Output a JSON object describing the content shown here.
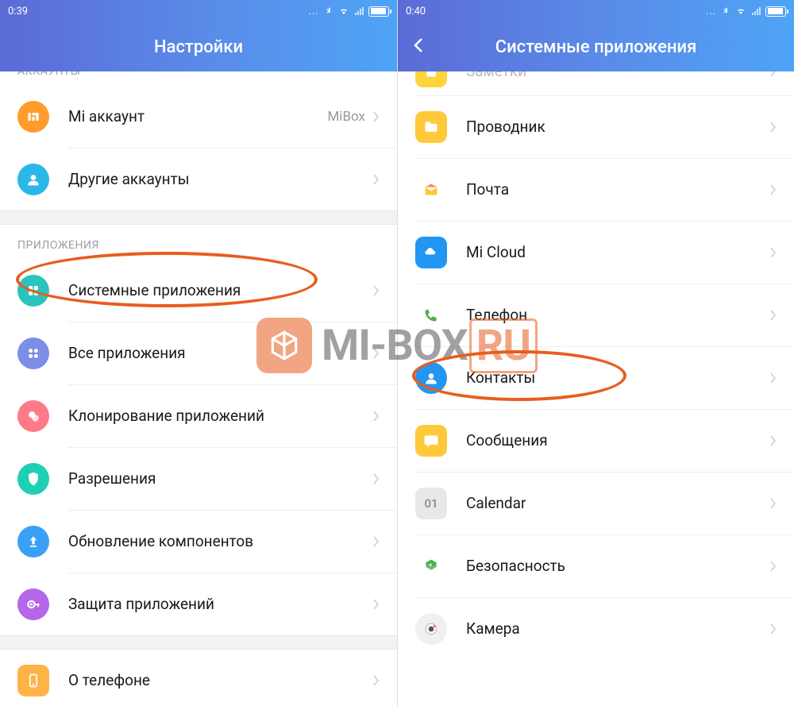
{
  "left": {
    "status_time": "0:39",
    "header_title": "Настройки",
    "section_accounts": "АККАУНТЫ",
    "section_apps": "ПРИЛОЖЕНИЯ",
    "rows": {
      "mi_account": {
        "label": "Mi аккаунт",
        "value": "MiBox"
      },
      "other_accounts": {
        "label": "Другие аккаунты"
      },
      "system_apps": {
        "label": "Системные приложения"
      },
      "all_apps": {
        "label": "Все приложения"
      },
      "clone_apps": {
        "label": "Клонирование приложений"
      },
      "permissions": {
        "label": "Разрешения"
      },
      "component_update": {
        "label": "Обновление компонентов"
      },
      "app_lock": {
        "label": "Защита приложений"
      },
      "about_phone": {
        "label": "О телефоне"
      }
    }
  },
  "right": {
    "status_time": "0:40",
    "header_title": "Системные приложения",
    "rows": {
      "notes": {
        "label": "Заметки"
      },
      "explorer": {
        "label": "Проводник"
      },
      "mail": {
        "label": "Почта"
      },
      "micloud": {
        "label": "Mi Cloud"
      },
      "phone": {
        "label": "Телефон"
      },
      "contacts": {
        "label": "Контакты"
      },
      "messages": {
        "label": "Сообщения"
      },
      "calendar": {
        "label": "Calendar",
        "badge": "01"
      },
      "security": {
        "label": "Безопасность"
      },
      "camera": {
        "label": "Камера"
      }
    }
  },
  "watermark": {
    "text_main": "MI-BOX",
    "text_suffix": "RU"
  }
}
